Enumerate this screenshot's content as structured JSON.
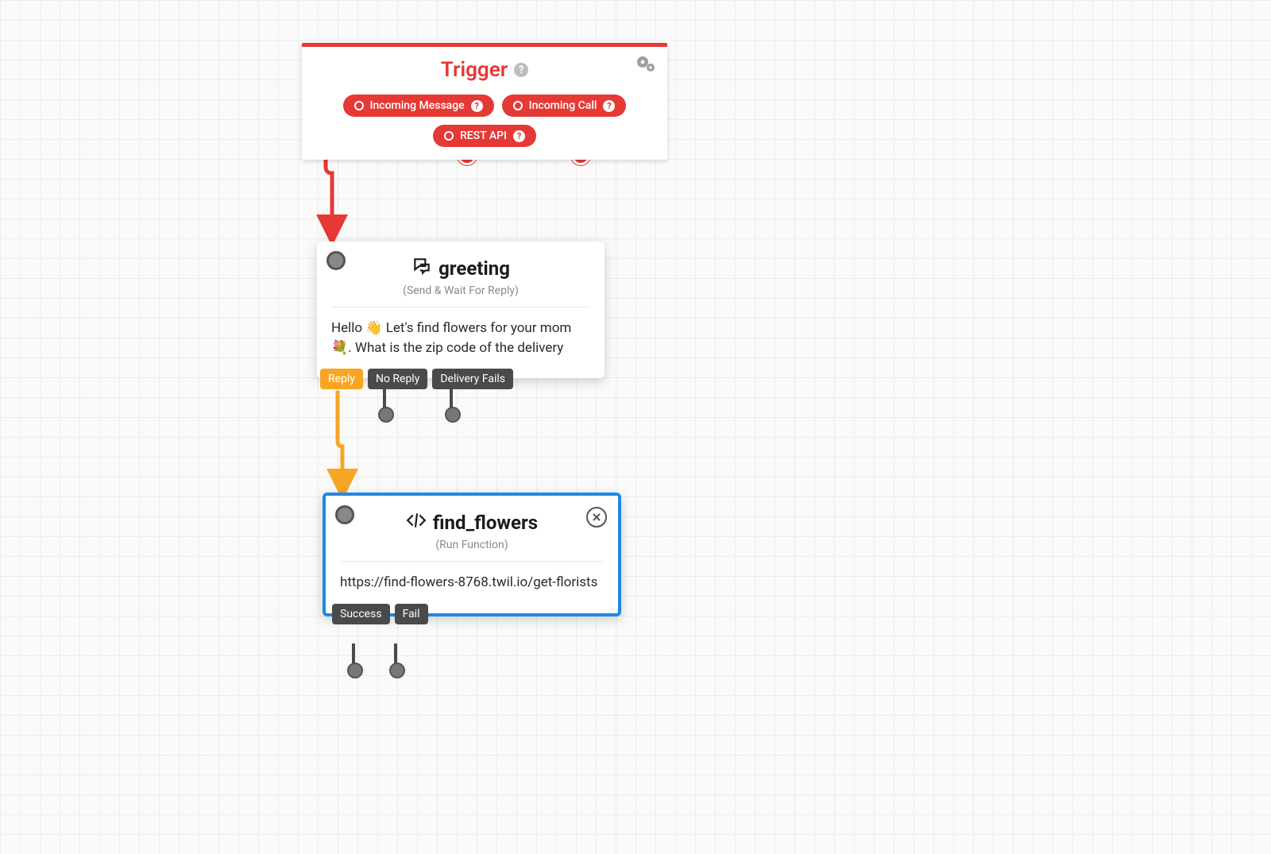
{
  "trigger": {
    "title": "Trigger",
    "pills": {
      "incoming_message": "Incoming Message",
      "incoming_call": "Incoming Call",
      "rest_api": "REST API"
    }
  },
  "greeting": {
    "title": "greeting",
    "subtitle": "(Send & Wait For Reply)",
    "body": "Hello 👋 Let's find flowers for your mom 💐. What is the zip code of the delivery",
    "outports": {
      "reply": "Reply",
      "no_reply": "No Reply",
      "delivery_fails": "Delivery Fails"
    }
  },
  "find_flowers": {
    "title": "find_flowers",
    "subtitle": "(Run Function)",
    "body": "https://find-flowers-8768.twil.io/get-florists",
    "outports": {
      "success": "Success",
      "fail": "Fail"
    }
  },
  "colors": {
    "accent_red": "#e53935",
    "accent_orange": "#f6a623",
    "selected_blue": "#1e88e5"
  }
}
